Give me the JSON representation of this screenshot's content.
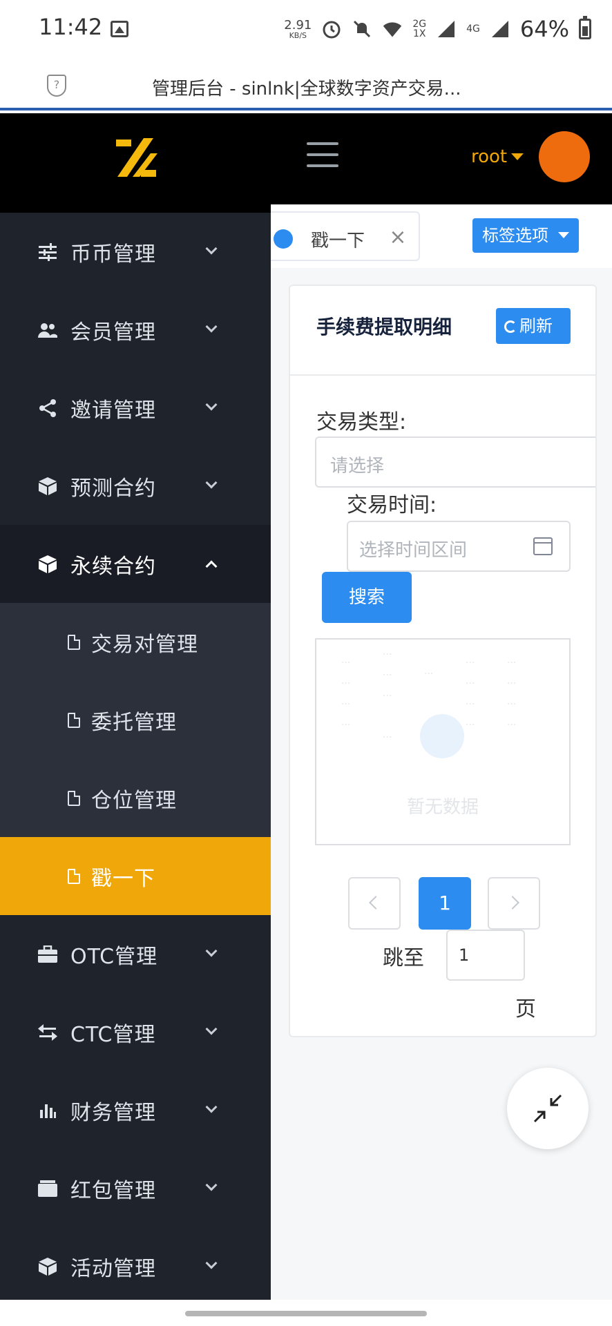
{
  "status_bar": {
    "time": "11:42",
    "net_speed_value": "2.91",
    "net_speed_unit": "KB/S",
    "sim1_label": "2G",
    "sim1_sub": "1X",
    "sim2_label": "4G",
    "battery": "64%"
  },
  "browser": {
    "page_title": "管理后台 - sinlnk|全球数字资产交易..."
  },
  "header": {
    "user_name": "root",
    "avatar_color": "#ef6c0e",
    "accent_color": "#f0a70a"
  },
  "sidebar": {
    "items": [
      {
        "label": "币币管理",
        "icon": "sliders-icon"
      },
      {
        "label": "会员管理",
        "icon": "users-icon"
      },
      {
        "label": "邀请管理",
        "icon": "share-icon"
      },
      {
        "label": "预测合约",
        "icon": "cube-icon"
      },
      {
        "label": "永续合约",
        "icon": "cube-icon",
        "expanded": true
      },
      {
        "label": "OTC管理",
        "icon": "briefcase-icon"
      },
      {
        "label": "CTC管理",
        "icon": "swap-icon"
      },
      {
        "label": "财务管理",
        "icon": "bar-chart-icon"
      },
      {
        "label": "红包管理",
        "icon": "wallet-icon"
      },
      {
        "label": "活动管理",
        "icon": "cube-icon"
      }
    ],
    "subitems": [
      {
        "label": "交易对管理"
      },
      {
        "label": "委托管理"
      },
      {
        "label": "仓位管理"
      },
      {
        "label": "戳一下",
        "active": true
      }
    ]
  },
  "tabs": {
    "current": "戳一下",
    "options_label": "标签选项"
  },
  "card": {
    "title": "手续费提取明细",
    "refresh_label": "刷新",
    "trade_type_label": "交易类型:",
    "trade_type_placeholder": "请选择",
    "trade_time_label": "交易时间:",
    "trade_time_placeholder": "选择时间区间",
    "search_label": "搜索",
    "empty_text": "暂无数据"
  },
  "pagination": {
    "current_page": "1",
    "jump_label": "跳至",
    "jump_value": "1",
    "page_suffix": "页"
  }
}
